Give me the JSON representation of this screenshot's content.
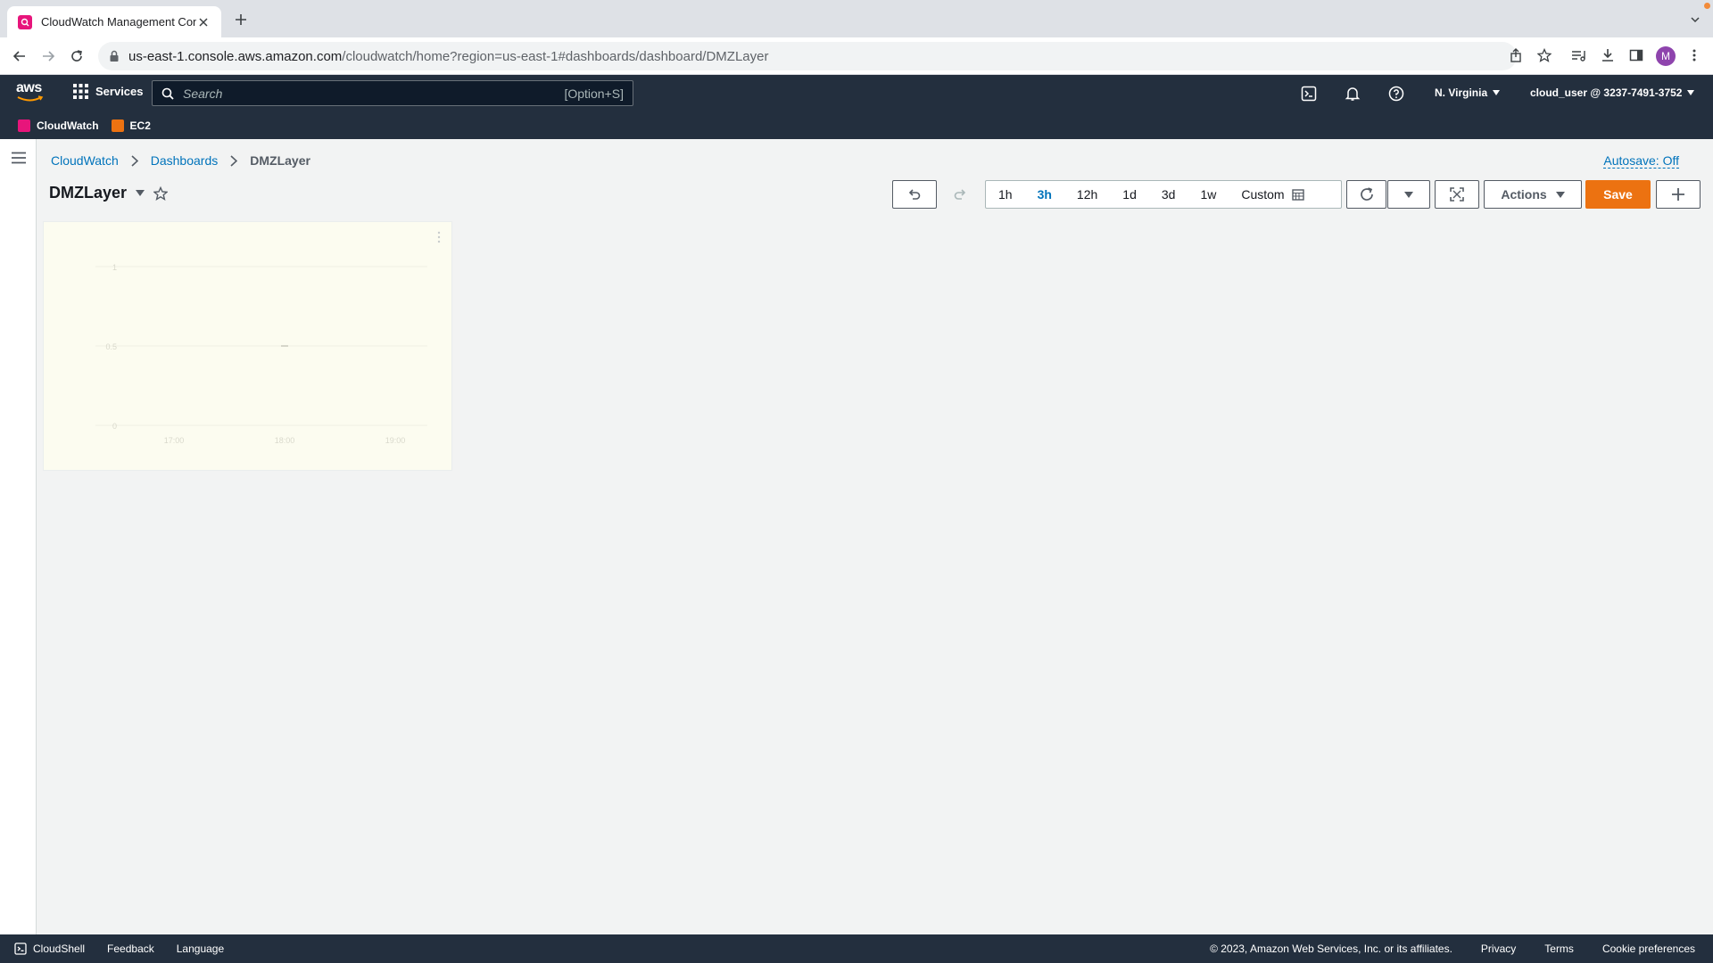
{
  "browser": {
    "tab_title": "CloudWatch Management Con",
    "url_host": "us-east-1.console.aws.amazon.com",
    "url_path": "/cloudwatch/home?region=us-east-1#dashboards/dashboard/DMZLayer",
    "profile_initial": "M"
  },
  "aws_header": {
    "logo": "aws",
    "services_label": "Services",
    "search_placeholder": "Search",
    "search_shortcut": "[Option+S]",
    "region": "N. Virginia",
    "account": "cloud_user @ 3237-7491-3752"
  },
  "favorites": [
    {
      "label": "CloudWatch",
      "color": "#e7157b"
    },
    {
      "label": "EC2",
      "color": "#ec7211"
    }
  ],
  "breadcrumb": {
    "items": [
      "CloudWatch",
      "Dashboards"
    ],
    "current": "DMZLayer"
  },
  "autosave": "Autosave: Off",
  "dashboard": {
    "title": "DMZLayer"
  },
  "toolbar": {
    "time_ranges": [
      "1h",
      "3h",
      "12h",
      "1d",
      "3d",
      "1w"
    ],
    "active_range": "3h",
    "custom_label": "Custom",
    "actions_label": "Actions",
    "save_label": "Save"
  },
  "widget": {
    "chart_data": {
      "type": "line",
      "title": "",
      "xlabel": "",
      "ylabel": "",
      "x_ticks": [
        "17:00",
        "18:00",
        "19:00"
      ],
      "y_ticks": [
        "1",
        "0.5",
        "0"
      ],
      "ylim": [
        0,
        1
      ],
      "series": [
        {
          "x": [
            "18:00"
          ],
          "values": [
            0.5
          ]
        }
      ]
    }
  },
  "footer": {
    "cloudshell": "CloudShell",
    "feedback": "Feedback",
    "language": "Language",
    "copyright": "© 2023, Amazon Web Services, Inc. or its affiliates.",
    "privacy": "Privacy",
    "terms": "Terms",
    "cookies": "Cookie preferences"
  },
  "colors": {
    "aws_nav": "#232f3e",
    "link": "#0073bb",
    "primary_button": "#ec7211",
    "widget_bg": "#fcfcf0"
  },
  "icons": [
    "back-icon",
    "forward-icon",
    "reload-icon",
    "lock-icon",
    "share-icon",
    "bookmark-star-icon",
    "reading-list-icon",
    "download-icon",
    "side-panel-icon",
    "kebab-icon",
    "grid-icon",
    "search-icon",
    "cloudshell-icon",
    "bell-icon",
    "help-icon",
    "hamburger-icon",
    "chevron-right-icon",
    "star-icon",
    "undo-icon",
    "redo-icon",
    "calendar-icon",
    "refresh-icon",
    "caret-down-icon",
    "fullscreen-icon",
    "plus-icon"
  ]
}
